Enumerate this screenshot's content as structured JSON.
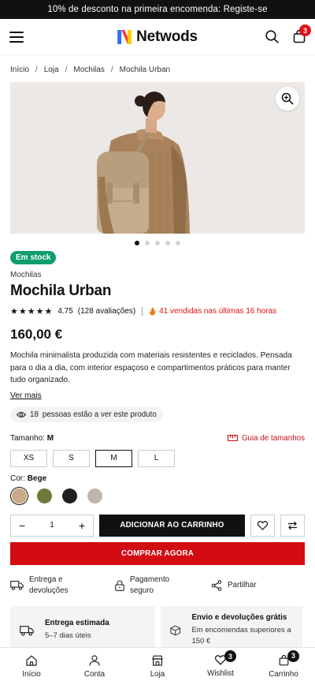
{
  "promo": {
    "text": "10% de desconto na primeira encomenda: Registe-se"
  },
  "header": {
    "brand": "Netwods",
    "cart_count": "3"
  },
  "breadcrumb": [
    "Início",
    "Loja",
    "Mochilas",
    "Mochila Urban"
  ],
  "gallery": {
    "image_count": 5,
    "active_index": 0
  },
  "product": {
    "stock_badge": "Em stock",
    "category": "Mochilas",
    "name": "Mochila Urban",
    "rating": "4.75",
    "reviews": "(128 avaliações)",
    "sold": "41 vendidas nas últimas 16 horas",
    "price": "160,00 €",
    "description": "Mochila minimalista produzida com materiais resistentes e reciclados. Pensada para o dia a dia, com interior espaçoso e compartimentos práticos para manter tudo organizado.",
    "read_more": "Ver mais",
    "viewers": "18",
    "viewers_text": "pessoas estão a ver este produto"
  },
  "size": {
    "label": "Tamanho:",
    "selected": "M",
    "guide": "Guia de tamanhos",
    "options": [
      "XS",
      "S",
      "M",
      "L"
    ]
  },
  "color": {
    "label": "Cor:",
    "selected": "Bege",
    "swatches": [
      "#c9ac86",
      "#6e7a3a",
      "#1f1f1f",
      "#bdb6ac"
    ]
  },
  "purchase": {
    "qty": "1",
    "add_to_cart": "ADICIONAR AO CARRINHO",
    "buy_now": "COMPRAR AGORA"
  },
  "features": [
    {
      "icon": "truck-icon",
      "text": "Entrega e devoluções"
    },
    {
      "icon": "lock-icon",
      "text": "Pagamento seguro"
    },
    {
      "icon": "share-icon",
      "text": "Partilhar"
    }
  ],
  "cards": [
    {
      "icon": "truck-icon",
      "title": "Entrega estimada",
      "sub": "5–7 dias úteis"
    },
    {
      "icon": "box-icon",
      "title": "Envio e devoluções grátis",
      "sub": "Em encomendas superiores a 150 €"
    }
  ],
  "bottom_nav": [
    {
      "label": "Início",
      "icon": "home-icon"
    },
    {
      "label": "Conta",
      "icon": "user-icon"
    },
    {
      "label": "Loja",
      "icon": "store-icon"
    },
    {
      "label": "Wishlist",
      "icon": "heart-icon",
      "badge": "3"
    },
    {
      "label": "Carrinho",
      "icon": "bag-icon",
      "badge": "3"
    }
  ],
  "colors": {
    "accent_red": "#d30b12",
    "stock_green": "#0f9d6b"
  }
}
